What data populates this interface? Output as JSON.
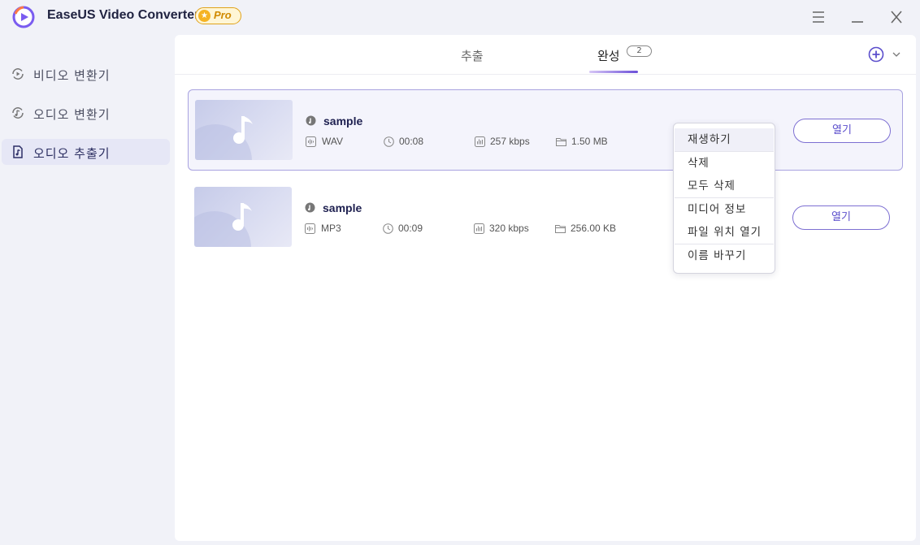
{
  "app": {
    "title": "EaseUS Video Converter",
    "badge": "Pro",
    "accent_color": "#6b4fd8"
  },
  "window_controls": [
    {
      "name": "menu-icon"
    },
    {
      "name": "minimize-icon"
    },
    {
      "name": "close-icon"
    }
  ],
  "sidebar": {
    "items": [
      {
        "label": "비디오 변환기",
        "icon": "video-convert-icon",
        "active": false
      },
      {
        "label": "오디오 변환기",
        "icon": "audio-convert-icon",
        "active": false
      },
      {
        "label": "오디오 추출기",
        "icon": "audio-extract-icon",
        "active": true
      }
    ]
  },
  "tabs": {
    "extract_label": "추출",
    "done_label": "완성",
    "done_count": "2"
  },
  "files": [
    {
      "name": "sample",
      "format": "WAV",
      "duration": "00:08",
      "bitrate": "257 kbps",
      "size": "1.50 MB",
      "open_label": "열기",
      "selected": true
    },
    {
      "name": "sample",
      "format": "MP3",
      "duration": "00:09",
      "bitrate": "320 kbps",
      "size": "256.00 KB",
      "open_label": "열기",
      "selected": false
    }
  ],
  "context_menu": {
    "items": [
      {
        "label": "재생하기",
        "hover": true
      },
      {
        "label": "삭제"
      },
      {
        "label": "모두 삭제"
      },
      {
        "label": "미디어 정보"
      },
      {
        "label": "파일 위치 열기"
      },
      {
        "label": "이름 바꾸기"
      }
    ]
  }
}
